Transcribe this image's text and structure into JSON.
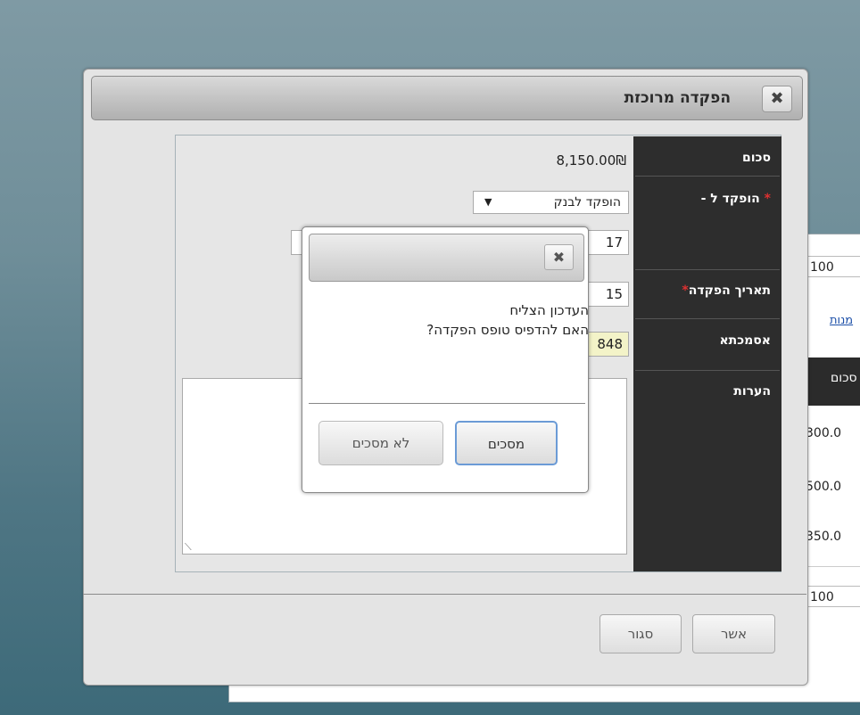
{
  "background_window": {
    "rows": [
      "100",
      "100"
    ],
    "link": "מנות",
    "header": "סכום",
    "values": [
      "300.0",
      "500.0",
      "350.0"
    ]
  },
  "dialog": {
    "title": "הפקדה מרוכזת",
    "close_symbol": "✖",
    "labels": {
      "amount": "סכום",
      "deposit_to": "הופקד ל -",
      "deposit_date": "תאריך הפקדה",
      "reference": "אסמכתא",
      "notes": "הערות"
    },
    "required_mark": "*",
    "amount_value": "8,150.00₪",
    "deposit_to_value": "הופקד לבנק",
    "deposit_to_arrow": "▼",
    "field_values": {
      "row1": "17",
      "date": "15",
      "reference": "848"
    },
    "buttons": {
      "confirm": "אשר",
      "close": "סגור"
    }
  },
  "message_box": {
    "close_symbol": "✖",
    "line1": "העדכון הצליח",
    "line2": "האם להדפיס טופס הפקדה?",
    "agree": "מסכים",
    "disagree": "לא מסכים"
  }
}
